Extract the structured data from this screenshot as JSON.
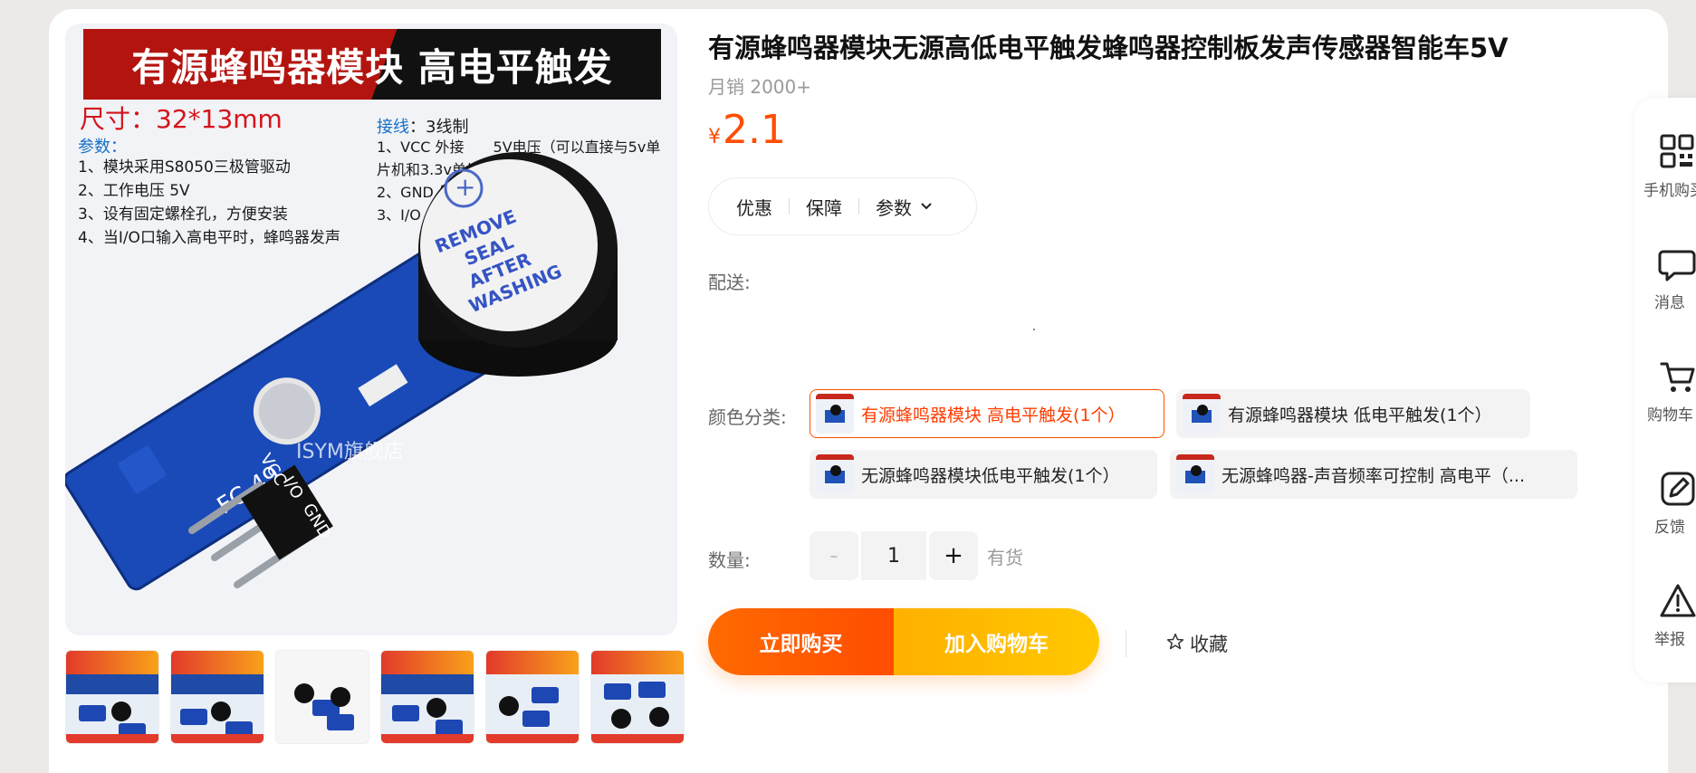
{
  "main_image": {
    "banner": "有源蜂鸣器模块 高电平触发",
    "size_label": "尺寸：32*13mm",
    "params_title": "参数：",
    "params": [
      "1、模块采用S8050三极管驱动",
      "2、工作电压 5V",
      "3、设有固定螺栓孔，方便安装",
      "4、当I/O口输入高电平时，蜂鸣器发声"
    ],
    "wiring_key": "接线",
    "wiring_value": "：3线制",
    "wiring": [
      "1、VCC 外接　　5V电压（可以直接与5v单片机和3.3v单片机相连）",
      "2、GND 外接GND",
      "3、I/O 外接单片机IO口"
    ],
    "buzzer_text": [
      "REMOVE",
      "SEAL",
      "AFTER",
      "WASHING"
    ],
    "board_text": "FC-49",
    "pin_labels": [
      "VCC",
      "I/O",
      "GND"
    ],
    "watermark": "ISYM旗舰店"
  },
  "thumbnails": [
    {
      "name": "thumb-1"
    },
    {
      "name": "thumb-2"
    },
    {
      "name": "thumb-3"
    },
    {
      "name": "thumb-4"
    },
    {
      "name": "thumb-5"
    },
    {
      "name": "thumb-6"
    }
  ],
  "product": {
    "title": "有源蜂鸣器模块无源高低电平触发蜂鸣器控制板发声传感器智能车5V",
    "sales": "月销 2000+",
    "currency": "¥",
    "price": "2.1"
  },
  "info_tabs": {
    "promo": "优惠",
    "guarantee": "保障",
    "params": "参数"
  },
  "delivery_label": "配送:",
  "color_label": "颜色分类:",
  "color_options": [
    {
      "label": "有源蜂鸣器模块 高电平触发(1个）",
      "selected": true
    },
    {
      "label": "有源蜂鸣器模块 低电平触发(1个）",
      "selected": false
    },
    {
      "label": "无源蜂鸣器模块低电平触发(1个）",
      "selected": false
    },
    {
      "label": "无源蜂鸣器-声音频率可控制 高电平（...",
      "selected": false
    }
  ],
  "quantity_label": "数量:",
  "quantity": {
    "minus": "-",
    "value": "1",
    "plus": "+",
    "stock": "有货"
  },
  "actions": {
    "buy_now": "立即购买",
    "add_cart": "加入购物车",
    "favorite": "收藏"
  },
  "sidebar": {
    "mobile": "手机购买",
    "message": "消息",
    "cart": "购物车",
    "feedback": "反馈",
    "report": "举报"
  },
  "colors": {
    "accent": "#ff4d00",
    "buy_now_bg": "#ff5a00",
    "add_cart_bg": "#ffbd00"
  }
}
